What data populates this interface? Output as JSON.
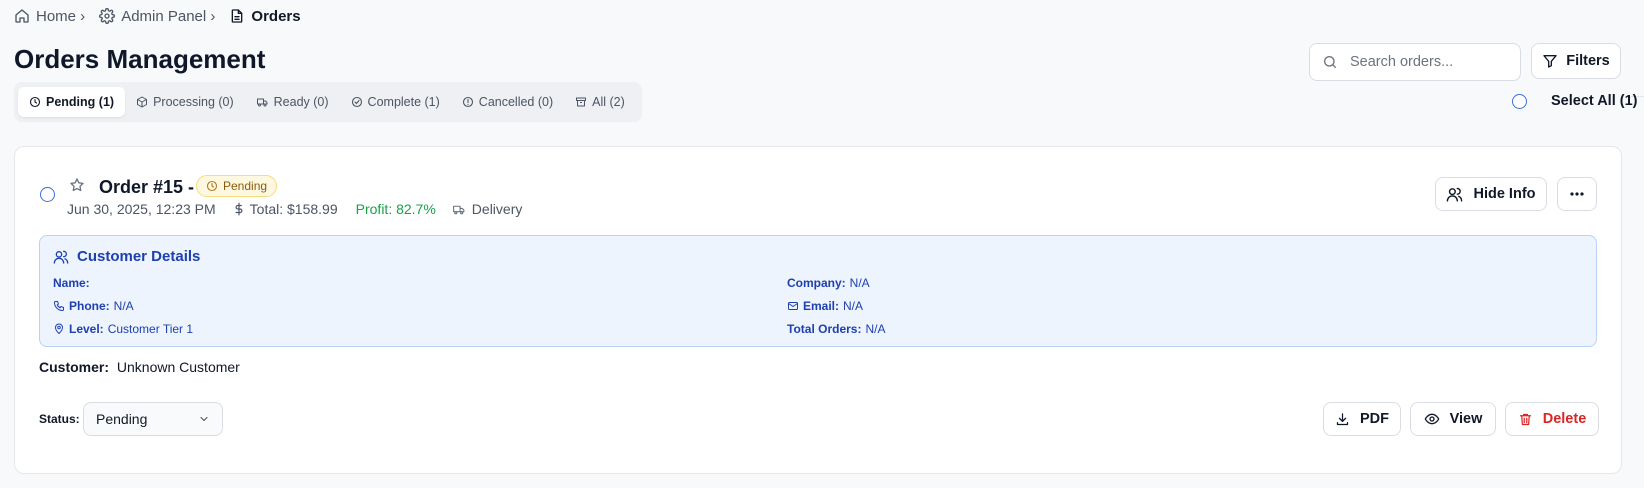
{
  "breadcrumb": [
    {
      "label": "Home ›",
      "icon": "home-icon"
    },
    {
      "label": "Admin Panel ›",
      "icon": "gear-icon"
    },
    {
      "label": "Orders",
      "icon": "document-icon"
    }
  ],
  "page_title": "Orders Management",
  "search": {
    "placeholder": "Search orders...",
    "value": ""
  },
  "filters_label": "Filters",
  "tabs": [
    {
      "label": "Pending (1)",
      "icon": "clock-icon",
      "active": true
    },
    {
      "label": "Processing (0)",
      "icon": "box-icon",
      "active": false
    },
    {
      "label": "Ready (0)",
      "icon": "truck-icon",
      "active": false
    },
    {
      "label": "Complete (1)",
      "icon": "check-circle-icon",
      "active": false
    },
    {
      "label": "Cancelled (0)",
      "icon": "info-circle-icon",
      "active": false
    },
    {
      "label": "All (2)",
      "icon": "archive-icon",
      "active": false
    }
  ],
  "select_all_label": "Select All (1)",
  "order": {
    "title": "Order #15 -",
    "status_badge": "Pending",
    "date": "Jun 30, 2025, 12:23 PM",
    "total": "Total: $158.99",
    "profit": "Profit: 82.7%",
    "delivery": "Delivery",
    "hide_info_label": "Hide Info",
    "customer_details": {
      "header": "Customer Details",
      "name_label": "Name:",
      "name_value": "",
      "phone_label": "Phone:",
      "phone_value": "N/A",
      "level_label": "Level:",
      "level_value": "Customer Tier 1",
      "company_label": "Company:",
      "company_value": "N/A",
      "email_label": "Email:",
      "email_value": "N/A",
      "total_orders_label": "Total Orders:",
      "total_orders_value": "N/A"
    },
    "customer_label": "Customer:",
    "customer_value": "Unknown Customer",
    "status_label": "Status:",
    "status_value": "Pending",
    "actions": {
      "pdf": "PDF",
      "view": "View",
      "delete": "Delete"
    }
  },
  "colors": {
    "accent_blue": "#1e40af",
    "details_bg": "#edf4fe",
    "profit_green": "#16a34a",
    "delete_red": "#dc2626",
    "pending_badge_bg": "#fef8e1"
  }
}
